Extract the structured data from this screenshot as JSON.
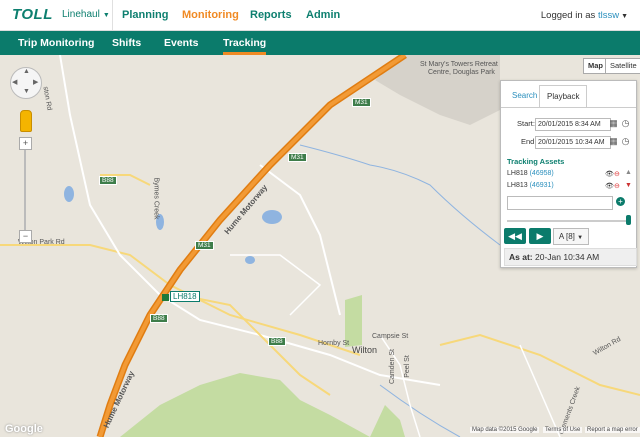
{
  "app": {
    "logo": "TOLL",
    "org": "Linehaul",
    "nav": [
      "Planning",
      "Monitoring",
      "Reports",
      "Admin"
    ],
    "active_nav": "Monitoring",
    "login_prefix": "Logged in as",
    "user": "tlssw"
  },
  "subnav": [
    "Trip Monitoring",
    "Shifts",
    "Events",
    "Tracking"
  ],
  "active_subnav": "Tracking",
  "map": {
    "type_buttons": [
      "Map",
      "Satellite"
    ],
    "labels": {
      "poi1": "St Mary's Towers Retreat",
      "poi2": "Centre, Douglas Park",
      "motorway1": "Hume Motorway",
      "motorway2": "Hume Motorway",
      "creek1": "Bymes Creek",
      "wilton_park": "Wilton Park Rd",
      "campsie": "Campsie St",
      "hornby": "Hornby St",
      "wilton": "Wilton",
      "camden": "Camden St",
      "peel": "Peel St",
      "wilton_rd": "Wilton Rd",
      "clements": "Clements Creek",
      "ston_rd": "ston Rd"
    },
    "road_tags": [
      "M31",
      "M31",
      "M31",
      "B88",
      "B88",
      "B88"
    ],
    "vehicle_label": "LH818",
    "google": "Google",
    "attribution": [
      "Map data ©2015 Google",
      "Terms of Use",
      "Report a map error"
    ],
    "colors": {
      "motorway": "#f29a35",
      "road": "#f7d87a",
      "water": "#8fb4e0",
      "park": "#c4dca2",
      "urban": "#d6d2ca"
    }
  },
  "panel": {
    "tabs": [
      "Search",
      "Playback"
    ],
    "active_tab": "Playback",
    "start_label": "Start:",
    "start_value": "20/01/2015 8:34 AM",
    "end_label": "End:",
    "end_value": "20/01/2015 10:34 AM",
    "section_title": "Tracking Assets",
    "assets": [
      {
        "id": "LH818",
        "number": "(46958)"
      },
      {
        "id": "LH813",
        "number": "(46931)"
      }
    ],
    "speed": "A [8]",
    "as_at_label": "As at:",
    "as_at_value": "20-Jan 10:34 AM"
  }
}
